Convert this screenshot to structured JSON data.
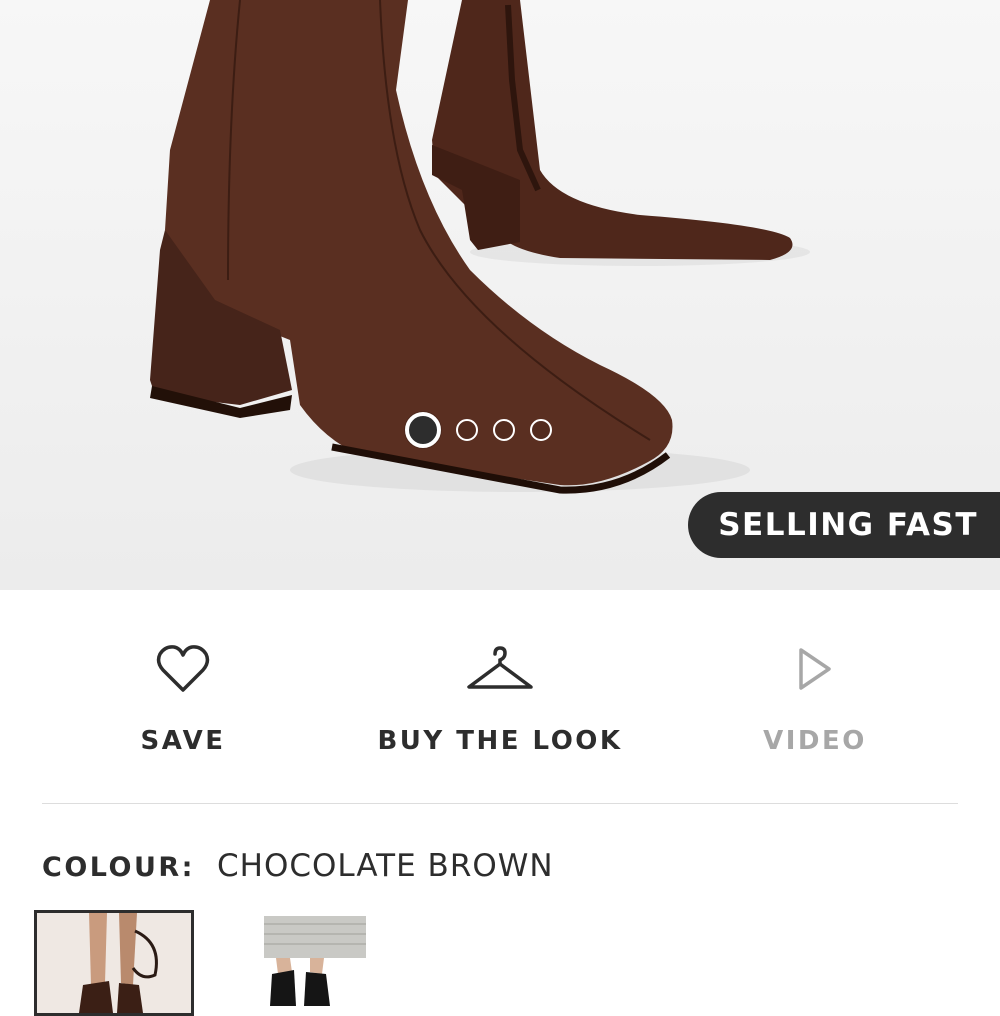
{
  "gallery": {
    "image_alt": "Chocolate brown suede square-toe ankle boots with block heel",
    "slides": 4,
    "active_slide": 1,
    "badge": "SELLING FAST"
  },
  "actions": {
    "save_label": "SAVE",
    "buy_the_look_label": "BUY THE LOOK",
    "video_label": "VIDEO"
  },
  "colour": {
    "label": "COLOUR:",
    "value": "CHOCOLATE BROWN",
    "swatches": [
      "chocolate-brown-thumbnail",
      "black-thumbnail"
    ]
  },
  "icons": {
    "save": "heart-icon",
    "buy_the_look": "hanger-icon",
    "video": "play-icon"
  },
  "colors": {
    "text": "#2d2d2d",
    "muted": "#a7a7a7",
    "badge_bg": "#2d2d2d",
    "boot": "#5a2f21"
  }
}
